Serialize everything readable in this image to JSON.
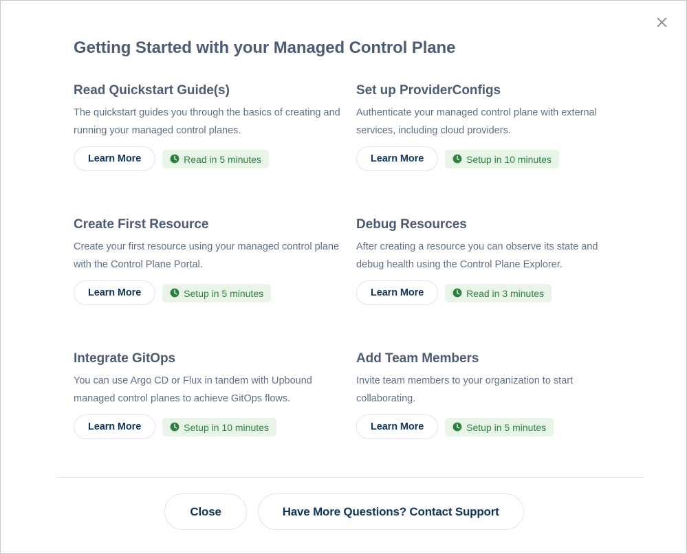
{
  "dialog": {
    "title": "Getting Started with your Managed Control Plane",
    "close_icon": "close-x-icon"
  },
  "colors": {
    "heading": "#4d5b73",
    "body_text": "#5f7086",
    "button_text": "#10355b",
    "badge_bg": "#e8f4e8",
    "badge_text": "#2f8040",
    "border": "#e3e3e8",
    "divider": "#e2e2e9"
  },
  "cards": [
    {
      "title": "Read Quickstart Guide(s)",
      "description": "The quickstart guides you through the basics of creating and running your managed control planes.",
      "button_label": "Learn More",
      "badge_label": "Read in 5 minutes",
      "badge_icon": "clock-icon"
    },
    {
      "title": "Set up ProviderConfigs",
      "description": "Authenticate your managed control plane with external services, including cloud providers.",
      "button_label": "Learn More",
      "badge_label": "Setup in 10 minutes",
      "badge_icon": "clock-icon"
    },
    {
      "title": "Create First Resource",
      "description": "Create your first resource using your managed control plane with the Control Plane Portal.",
      "button_label": "Learn More",
      "badge_label": "Setup in 5 minutes",
      "badge_icon": "clock-icon"
    },
    {
      "title": "Debug Resources",
      "description": "After creating a resource you can observe its state and debug health using the Control Plane Explorer.",
      "button_label": "Learn More",
      "badge_label": "Read in 3 minutes",
      "badge_icon": "clock-icon"
    },
    {
      "title": "Integrate GitOps",
      "description": "You can use Argo CD or Flux in tandem with Upbound managed control planes to achieve GitOps flows.",
      "button_label": "Learn More",
      "badge_label": "Setup in 10 minutes",
      "badge_icon": "clock-icon"
    },
    {
      "title": "Add Team Members",
      "description": "Invite team members to your organization to start collaborating.",
      "button_label": "Learn More",
      "badge_label": "Setup in 5 minutes",
      "badge_icon": "clock-icon"
    }
  ],
  "footer": {
    "close_label": "Close",
    "support_label": "Have More Questions? Contact Support"
  }
}
